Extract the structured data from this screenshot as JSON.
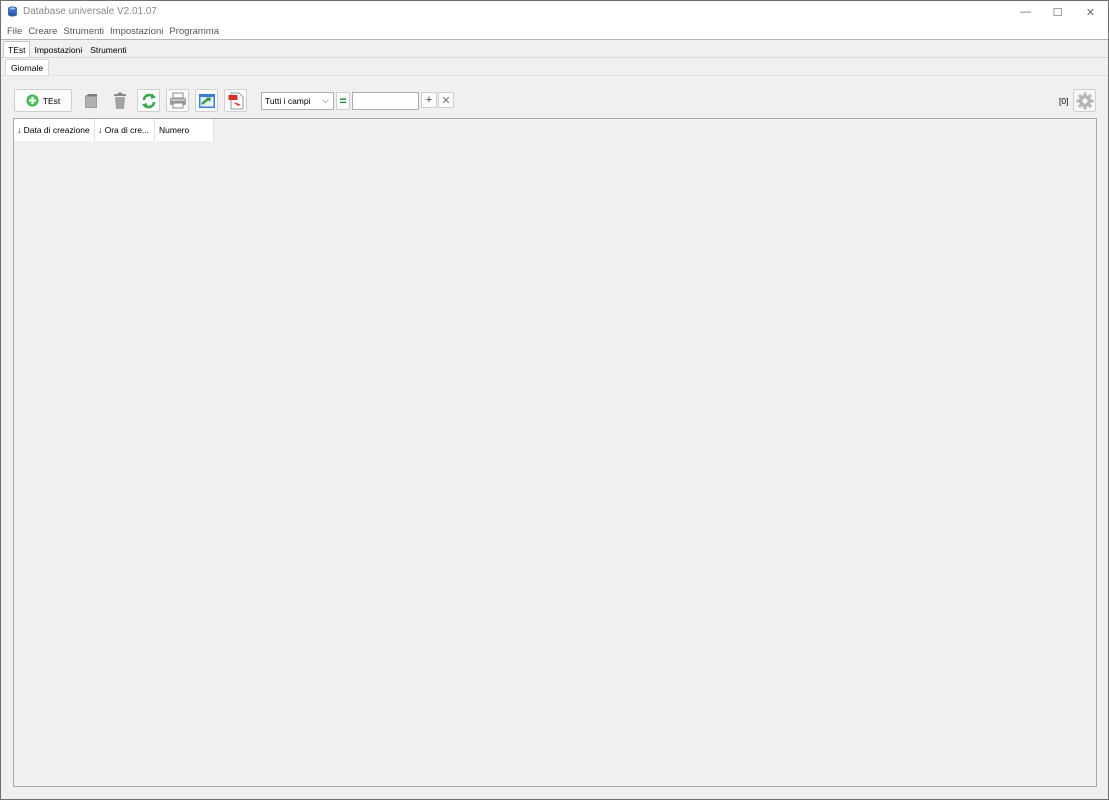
{
  "window": {
    "title": "Database universale V2.01.07",
    "controls": {
      "minimize": "—",
      "maximize": "☐",
      "close": "✕"
    }
  },
  "menu": {
    "items": [
      "File",
      "Creare",
      "Strumenti",
      "Impostazioni",
      "Programma"
    ]
  },
  "tabs": {
    "items": [
      "TEst",
      "Impostazioni",
      "Strumenti"
    ],
    "active": "TEst"
  },
  "subtabs": {
    "items": [
      "Giornale"
    ]
  },
  "toolbar": {
    "add_label": "TEst",
    "filter_field": "Tutti i campi",
    "operator": "=",
    "search_value": "",
    "add_filter": "+",
    "clear_filter": "✕",
    "count": "[0]",
    "icons": [
      "add-icon",
      "edit-icon",
      "delete-icon",
      "refresh-icon",
      "print-icon",
      "export-icon",
      "pdf-icon",
      "gear-icon"
    ],
    "colors": {
      "accent_green": "#3bb34a",
      "pdf_red": "#d9302b"
    }
  },
  "table": {
    "columns": [
      "↓ Data di creazione",
      "↓ Ora di cre...",
      "Numero"
    ],
    "rows": []
  }
}
